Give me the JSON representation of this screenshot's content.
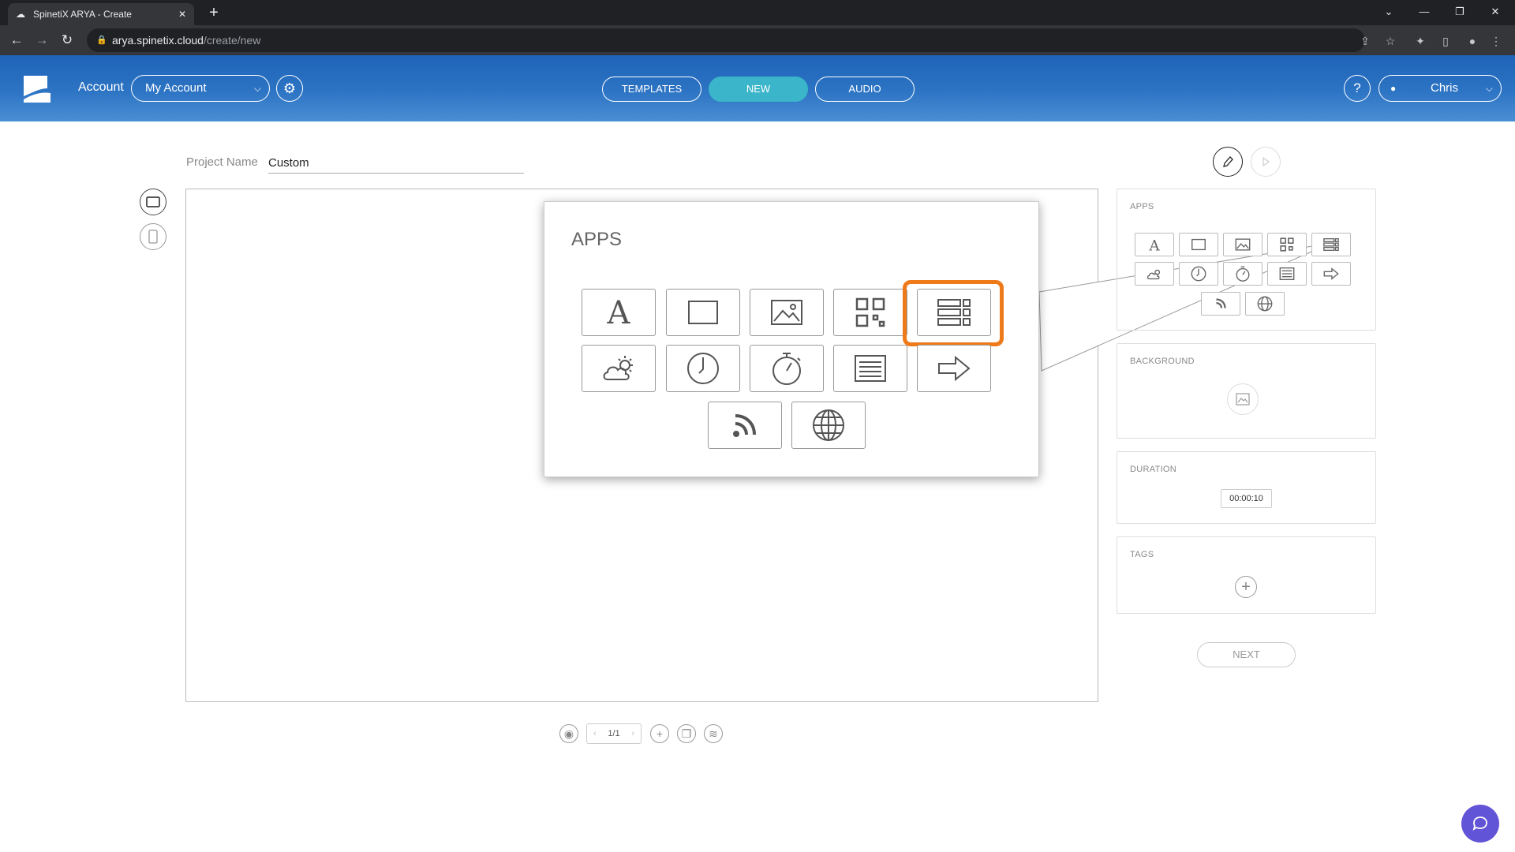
{
  "browser": {
    "tab_title": "SpinetiX ARYA - Create",
    "url_host": "arya.spinetix.cloud",
    "url_path": "/create/new"
  },
  "header": {
    "account_label": "Account",
    "account_value": "My Account",
    "nav": [
      "TEMPLATES",
      "NEW",
      "AUDIO"
    ],
    "active_nav": "NEW",
    "help": "?",
    "user": "Chris"
  },
  "project": {
    "name_label": "Project Name",
    "name_value": "Custom"
  },
  "zoom": {
    "title": "APPS",
    "highlighted_app": "multi-playlist-icon"
  },
  "panels": {
    "apps_title": "APPS",
    "background_title": "BACKGROUND",
    "duration_title": "DURATION",
    "duration_value": "00:00:10",
    "tags_title": "TAGS",
    "next_label": "NEXT"
  },
  "pager": "1/1",
  "colors": {
    "header_blue": "#2d74c4",
    "active_pill": "#3ab5c9",
    "highlight": "#ef7a1a",
    "chat": "#6254d6"
  }
}
